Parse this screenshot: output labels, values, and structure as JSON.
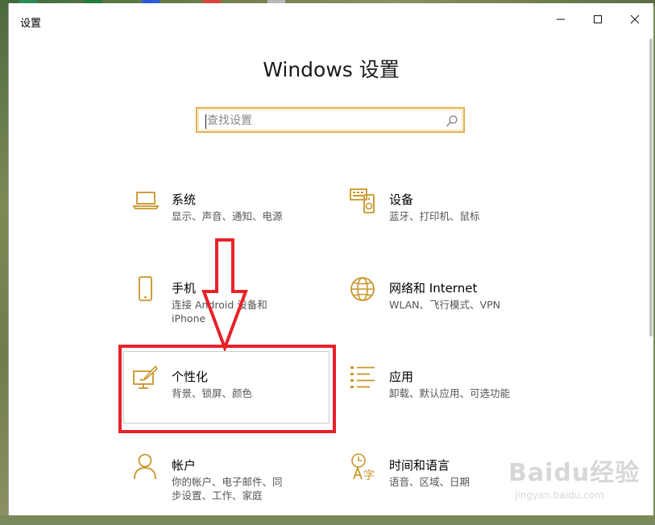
{
  "window": {
    "title": "设置"
  },
  "heading": "Windows 设置",
  "search": {
    "placeholder": "查找设置",
    "value": ""
  },
  "tiles": [
    {
      "name": "系统",
      "desc": "显示、声音、通知、电源",
      "icon": "laptop-icon"
    },
    {
      "name": "设备",
      "desc": "蓝牙、打印机、鼠标",
      "icon": "keyboard-icon"
    },
    {
      "name": "手机",
      "desc": "连接 Android 设备和 iPhone",
      "icon": "phone-icon"
    },
    {
      "name": "网络和 Internet",
      "desc": "WLAN、飞行模式、VPN",
      "icon": "globe-icon"
    },
    {
      "name": "个性化",
      "desc": "背景、锁屏、颜色",
      "icon": "paintbrush-icon"
    },
    {
      "name": "应用",
      "desc": "卸载、默认应用、可选功能",
      "icon": "apps-list-icon"
    },
    {
      "name": "帐户",
      "desc": "你的帐户、电子邮件、同步设置、工作、家庭",
      "icon": "person-icon"
    },
    {
      "name": "时间和语言",
      "desc": "语音、区域、日期",
      "icon": "time-language-icon"
    }
  ],
  "watermark": {
    "main": "Baidu经验",
    "sub": "jingyan.baidu.com"
  },
  "colors": {
    "accent": "#c8962a",
    "highlight": "#e8222a",
    "search_border": "#e0b04a"
  }
}
